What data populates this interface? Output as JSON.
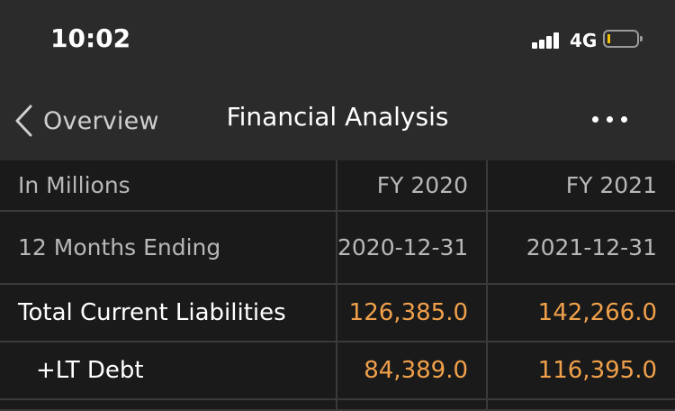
{
  "status_bar": {
    "time": "10:02",
    "network": "4G",
    "icons": [
      "signal-bars-icon",
      "battery-icon"
    ],
    "battery_color": "#f2c200"
  },
  "nav": {
    "back_label": "Overview",
    "title": "Financial Analysis",
    "icons": [
      "chevron-left-icon",
      "more-dots-icon"
    ]
  },
  "table": {
    "headers": [
      "In Millions",
      "FY 2020",
      "FY 2021"
    ],
    "period_row": [
      "12 Months Ending",
      "2020-12-31",
      "2021-12-31"
    ],
    "rows": [
      {
        "label": "Total Current Liabilities",
        "values": [
          "126,385.0",
          "142,266.0"
        ]
      },
      {
        "label": "+LT Debt",
        "values": [
          "84,389.0",
          "116,395.0"
        ]
      }
    ]
  },
  "colors": {
    "header_bg": "#2b2b2b",
    "page_bg": "#1a1a1a",
    "value_accent": "#f0a04b"
  }
}
